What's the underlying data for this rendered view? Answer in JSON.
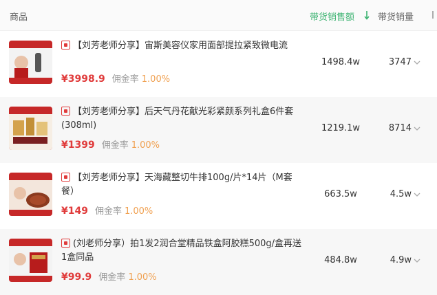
{
  "header": {
    "product_label": "商品",
    "sales_amount_label": "带货销售额",
    "sales_volume_label": "带货销量"
  },
  "colors": {
    "accent_green": "#3cb371",
    "price_red": "#e03b3b",
    "commission_orange": "#f0a050"
  },
  "products": [
    {
      "title": "【刘芳老师分享】宙斯美容仪家用面部提拉紧致微电流",
      "price": "¥3998.9",
      "commission_label": "佣金率",
      "commission_value": "1.00%",
      "sales_amount": "1498.4w",
      "sales_volume": "3747",
      "thumb_text": "气质团专属",
      "thumb_sub": "拍一拼干3件"
    },
    {
      "title": "【刘芳老师分享】后天气丹花献光彩紧颜系列礼盒6件套(308ml)",
      "price": "¥1399",
      "commission_label": "佣金率",
      "commission_value": "1.00%",
      "sales_amount": "1219.1w",
      "sales_volume": "8714",
      "thumb_text": "气质团专属",
      "thumb_sub": ""
    },
    {
      "title": "【刘芳老师分享】天海藏整切牛排100g/片*14片（M套餐）",
      "price": "¥149",
      "commission_label": "佣金率",
      "commission_value": "1.00%",
      "sales_amount": "663.5w",
      "sales_volume": "4.5w",
      "thumb_text": "气质团专属",
      "thumb_sub": "天海藏整切牛排"
    },
    {
      "title": "(刘老师分享）拍1发2润合堂精品铁盒阿胶糕500g/盒再送1盒同品",
      "price": "¥99.9",
      "commission_label": "佣金率",
      "commission_value": "1.00%",
      "sales_amount": "484.8w",
      "sales_volume": "4.9w",
      "thumb_text": "气质团专属",
      "thumb_sub": "拍一件干8盒"
    }
  ]
}
